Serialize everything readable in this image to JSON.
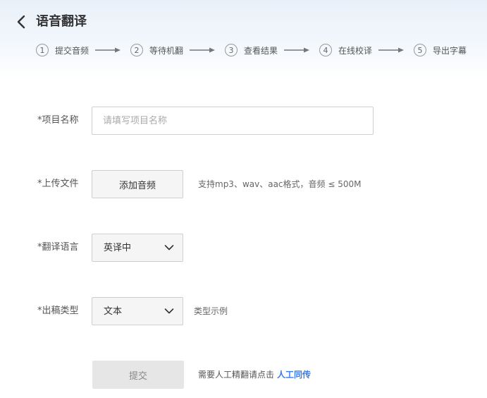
{
  "header": {
    "title": "语音翻译",
    "steps": [
      {
        "num": "1",
        "label": "提交音频"
      },
      {
        "num": "2",
        "label": "等待机翻"
      },
      {
        "num": "3",
        "label": "查看结果"
      },
      {
        "num": "4",
        "label": "在线校译"
      },
      {
        "num": "5",
        "label": "导出字幕"
      }
    ]
  },
  "form": {
    "project_name": {
      "label": "*项目名称",
      "placeholder": "请填写项目名称",
      "value": ""
    },
    "upload": {
      "label": "*上传文件",
      "button": "添加音频",
      "hint": "支持mp3、wav、aac格式，音频 ≤ 500M"
    },
    "language": {
      "label": "*翻译语言",
      "value": "英译中"
    },
    "output_type": {
      "label": "*出稿类型",
      "value": "文本",
      "example_link": "类型示例"
    }
  },
  "footer": {
    "submit": "提交",
    "hint": "需要人工精翻请点击",
    "link": "人工同传"
  },
  "colors": {
    "accent": "#3b7de8"
  }
}
